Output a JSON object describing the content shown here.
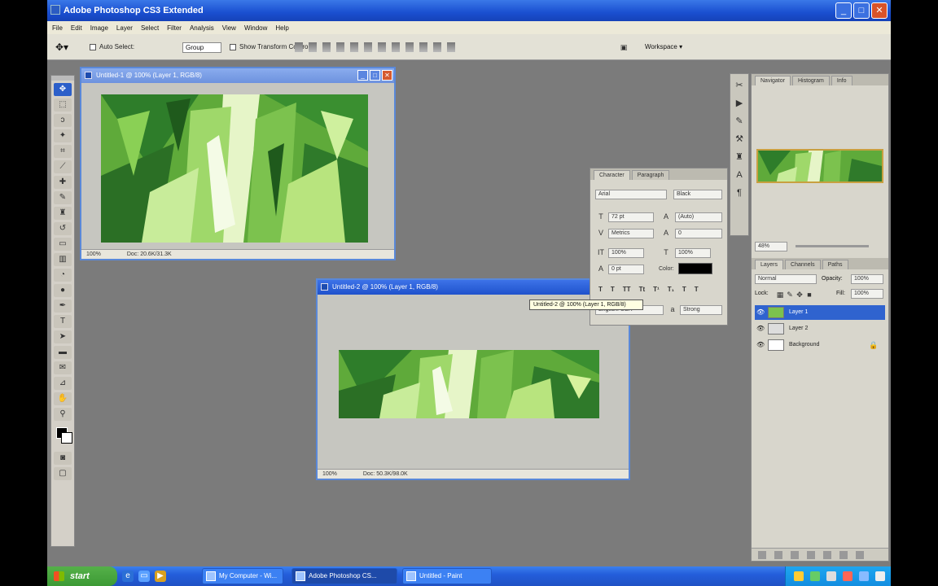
{
  "app": {
    "title": "Adobe Photoshop CS3 Extended",
    "minimize": "_",
    "maximize": "□",
    "close": "✕"
  },
  "menu": [
    "File",
    "Edit",
    "Image",
    "Layer",
    "Select",
    "Filter",
    "Analysis",
    "View",
    "Window",
    "Help"
  ],
  "options": {
    "auto_select_label": "Auto Select:",
    "auto_select_value": "Group",
    "transform_label": "Show Transform Controls",
    "workspace": "Workspace ▾"
  },
  "doc1": {
    "title": "Untitled-1 @ 100% (Layer 1, RGB/8)",
    "zoom": "100%",
    "status": "Doc: 20.6K/31.3K"
  },
  "doc2": {
    "title": "Untitled-2 @ 100% (Layer 1, RGB/8)",
    "zoom": "100%",
    "status": "Doc: 50.3K/98.0K"
  },
  "tooltip": "Untitled-2 @ 100% (Layer 1, RGB/8)",
  "character_panel": {
    "tab_character": "Character",
    "tab_paragraph": "Paragraph",
    "font_family": "Arial",
    "font_style": "Black",
    "font_size": "72 pt",
    "leading": "(Auto)",
    "kerning": "Metrics",
    "tracking": "0",
    "vscale": "100%",
    "hscale": "100%",
    "baseline": "0 pt",
    "color_label": "Color:",
    "language": "English: USA",
    "aa": "Strong"
  },
  "navigator": {
    "tab_navigator": "Navigator",
    "tab_histogram": "Histogram",
    "tab_info": "Info",
    "zoom": "48%"
  },
  "layers_panel": {
    "tab_layers": "Layers",
    "tab_channels": "Channels",
    "tab_paths": "Paths",
    "blend": "Normal",
    "opacity_label": "Opacity:",
    "opacity": "100%",
    "lock_label": "Lock:",
    "fill_label": "Fill:",
    "fill": "100%",
    "layers": [
      {
        "name": "Layer 1",
        "selected": true
      },
      {
        "name": "Layer 2",
        "selected": false
      },
      {
        "name": "Background",
        "selected": false
      }
    ]
  },
  "taskbar": {
    "start": "start",
    "items": [
      {
        "label": "My Computer - Wi..."
      },
      {
        "label": "Adobe Photoshop CS..."
      },
      {
        "label": "Untitled - Paint"
      }
    ]
  },
  "colors": {
    "title_blue": "#1a4fd0",
    "selection_blue": "#2f63cf",
    "workspace_gray": "#7b7b7b",
    "image_green": "#6ab042"
  }
}
